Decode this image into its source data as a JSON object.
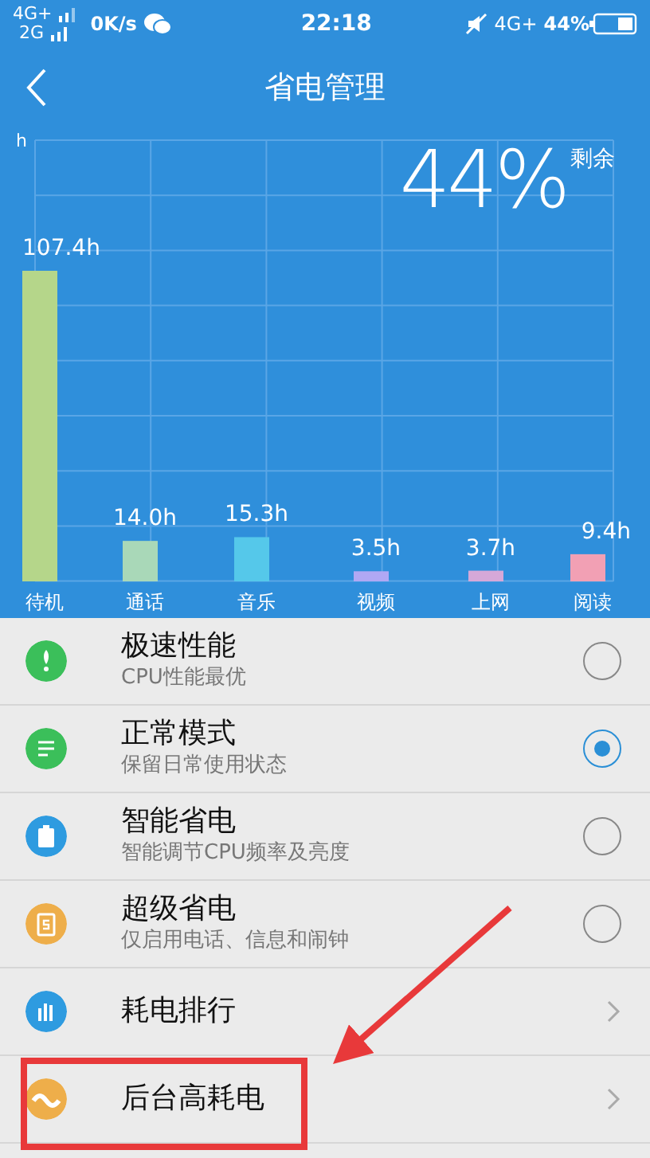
{
  "status_bar": {
    "left": [
      {
        "text": "4G+"
      },
      {
        "text": "2G"
      }
    ],
    "speed": "0K/s",
    "time": "22:18",
    "network": "4G+",
    "battery": "44%"
  },
  "header": {
    "title": "省电管理"
  },
  "summary": {
    "percent": "44%",
    "caption": "剩余"
  },
  "chart_data": {
    "type": "bar",
    "categories": [
      "待机",
      "通话",
      "音乐",
      "视频",
      "上网",
      "阅读"
    ],
    "annotations": [
      {
        "text": "h"
      }
    ],
    "series": [
      {
        "color": "#b5d68a",
        "values": [
          107.4,
          null,
          null,
          null,
          null,
          null
        ],
        "value_labels": [
          "107.4h",
          null,
          null,
          null,
          null,
          null
        ]
      },
      {
        "color": "#a9d8b8",
        "values": [
          null,
          14.0,
          null,
          null,
          null,
          null
        ],
        "value_labels": [
          null,
          "14.0h",
          null,
          null,
          null,
          null
        ]
      },
      {
        "color": "#55c8ea",
        "values": [
          null,
          null,
          15.3,
          null,
          null,
          null
        ],
        "value_labels": [
          null,
          null,
          "15.3h",
          null,
          null,
          null
        ]
      },
      {
        "color": "#b0a8f4",
        "values": [
          null,
          null,
          null,
          3.5,
          null,
          null
        ],
        "value_labels": [
          null,
          null,
          null,
          "3.5h",
          null,
          null
        ]
      },
      {
        "color": "#d6a8d8",
        "values": [
          null,
          null,
          null,
          null,
          3.7,
          null
        ],
        "value_labels": [
          null,
          null,
          null,
          null,
          "3.7h",
          null
        ]
      },
      {
        "color": "#f2a0b4",
        "values": [
          null,
          null,
          null,
          null,
          null,
          9.4
        ],
        "value_labels": [
          null,
          null,
          null,
          null,
          null,
          "9.4h"
        ]
      }
    ]
  },
  "items": [
    {
      "kind": "mode",
      "title": "极速性能",
      "subtitle": "CPU性能最优",
      "selected": false
    },
    {
      "kind": "mode",
      "title": "正常模式",
      "subtitle": "保留日常使用状态",
      "selected": true
    },
    {
      "kind": "mode",
      "title": "智能省电",
      "subtitle": "智能调节CPU频率及亮度",
      "selected": false
    },
    {
      "kind": "mode",
      "title": "超级省电",
      "subtitle": "仅启用电话、信息和闹钟",
      "selected": false
    },
    {
      "kind": "link",
      "title": "耗电排行"
    },
    {
      "kind": "link",
      "title": "后台高耗电"
    }
  ]
}
